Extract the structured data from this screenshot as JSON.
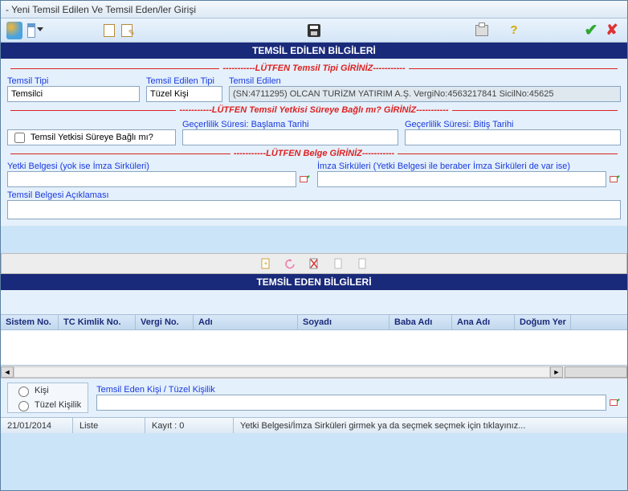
{
  "window": {
    "title": "- Yeni Temsil Edilen Ve Temsil Eden/ler Girişi"
  },
  "headers": {
    "temsil_edilen": "TEMSİL EDİLEN BİLGİLERİ",
    "temsil_eden": "TEMSİL EDEN BİLGİLERİ"
  },
  "dividers": {
    "tipi": "-----------LÜTFEN Temsil Tipi GİRİNİZ-----------",
    "sure": "-----------LÜTFEN Temsil Yetkisi Süreye Bağlı mı? GİRİNİZ-----------",
    "belge": "-----------LÜTFEN Belge GİRİNİZ-----------"
  },
  "labels": {
    "temsil_tipi": "Temsil Tipi",
    "temsil_edilen_tipi": "Temsil Edilen Tipi",
    "temsil_edilen": "Temsil Edilen",
    "sureye_bagli": "Temsil Yetkisi Süreye Bağlı mı?",
    "baslama": "Geçerlilik Süresi: Başlama Tarihi",
    "bitis": "Geçerlilik Süresi: Bitiş Tarihi",
    "yetki_belgesi": "Yetki Belgesi (yok ise İmza Sirküleri)",
    "imza_sirkuleri": "İmza Sirküleri (Yetki Belgesi ile beraber İmza Sirküleri de var ise)",
    "aciklama": "Temsil Belgesi Açıklaması",
    "kisi": "Kişi",
    "tuzel_kisilik": "Tüzel Kişilik",
    "te_kisi": "Temsil Eden Kişi / Tüzel Kişilik"
  },
  "values": {
    "temsil_tipi": "Temsilci",
    "temsil_edilen_tipi": "Tüzel Kişi",
    "temsil_edilen": "(SN:4711295) OLCAN TURİZM YATIRIM A.Ş. VergiNo:4563217841 SicilNo:45625",
    "baslama": "",
    "bitis": "",
    "aciklama": ""
  },
  "grid": {
    "columns": [
      "Sistem No.",
      "TC Kimlik No.",
      "Vergi No.",
      "Adı",
      "Soyadı",
      "Baba Adı",
      "Ana Adı",
      "Doğum Yer"
    ],
    "widths": [
      72,
      96,
      72,
      130,
      114,
      78,
      78,
      70
    ]
  },
  "status": {
    "date": "21/01/2014",
    "mode": "Liste",
    "record": "Kayıt : 0",
    "message": "Yetki Belgesi/İmza Sirküleri girmek ya da seçmek seçmek için tıklayınız..."
  }
}
